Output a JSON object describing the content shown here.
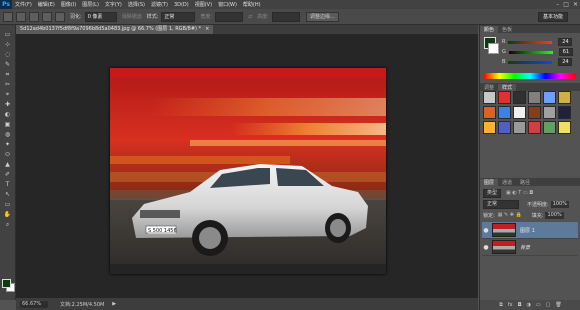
{
  "app": {
    "logo": "Ps"
  },
  "menu": [
    "文件(F)",
    "编辑(E)",
    "图像(I)",
    "图层(L)",
    "文字(Y)",
    "选择(S)",
    "滤镜(T)",
    "3D(D)",
    "视图(V)",
    "窗口(W)",
    "帮助(H)"
  ],
  "window_controls": {
    "minimize": "–",
    "maximize": "□",
    "close": "✕"
  },
  "options": {
    "feather_label": "羽化:",
    "feather_value": "0 像素",
    "antialias_label": "消除锯齿",
    "style_label": "样式:",
    "style_value": "正常",
    "width_label": "宽度:",
    "height_label": "高度:",
    "refine_edge": "调整边缘...",
    "workspace": "基本功能"
  },
  "tools": [
    "▭",
    "⊹",
    "◌",
    "✎",
    "⌗",
    "✂",
    "⌖",
    "✚",
    "◐",
    "▣",
    "◍",
    "✦",
    "⬭",
    "▲",
    "✐",
    "T",
    "↖",
    "▭",
    "✋",
    "⌕"
  ],
  "document": {
    "tab_title": "5d12ad4b0137f5df8f9a7096b8d5a0483.jpg @ 66.7% (图层 1, RGB/8#) *",
    "tab_close": "×",
    "zoom": "66.67%",
    "doc_info": "文档:2.25M/4.50M"
  },
  "panels": {
    "color_tabs": [
      "颜色",
      "色板"
    ],
    "color": {
      "rows": [
        {
          "label": "R",
          "value": "24",
          "color": "#ff3030"
        },
        {
          "label": "G",
          "value": "61",
          "color": "#30ff30"
        },
        {
          "label": "B",
          "value": "24",
          "color": "#3030ff"
        }
      ]
    },
    "adjust_tabs": [
      "调整",
      "样式"
    ],
    "style_swatches": [
      "#c8c8c8",
      "#e03030",
      "#303030",
      "#808080",
      "#6aa0ff",
      "#d0b040",
      "#e06020",
      "#4080e0",
      "#f0f0f0",
      "#804020",
      "#a0a0a0",
      "#202040",
      "#ffb030",
      "#5060c0",
      "#9a9a9a",
      "#d04040",
      "#60a060",
      "#f0e060"
    ],
    "layers_tabs": [
      "图层",
      "通道",
      "路径"
    ],
    "kind_label": "类型",
    "blend_mode": "正常",
    "opacity_label": "不透明度:",
    "opacity_value": "100%",
    "lock_label": "锁定:",
    "fill_label": "填充:",
    "fill_value": "100%",
    "layers": [
      {
        "name": "图层 1",
        "eye": "●",
        "selected": true
      },
      {
        "name": "背景",
        "eye": "●",
        "selected": false
      }
    ],
    "layer_footer_icons": [
      "link-icon",
      "fx-icon",
      "mask-icon",
      "adjustment-icon",
      "group-icon",
      "new-layer-icon",
      "delete-icon"
    ],
    "layer_footer_glyphs": [
      "⧉",
      "fx",
      "◘",
      "◑",
      "▭",
      "▢",
      "🗑"
    ]
  },
  "photo": {
    "plate": "S 500 1456"
  },
  "colors": {
    "foreground": "#0e3b10",
    "background": "#ffffff",
    "accent": "#31a8ff"
  }
}
